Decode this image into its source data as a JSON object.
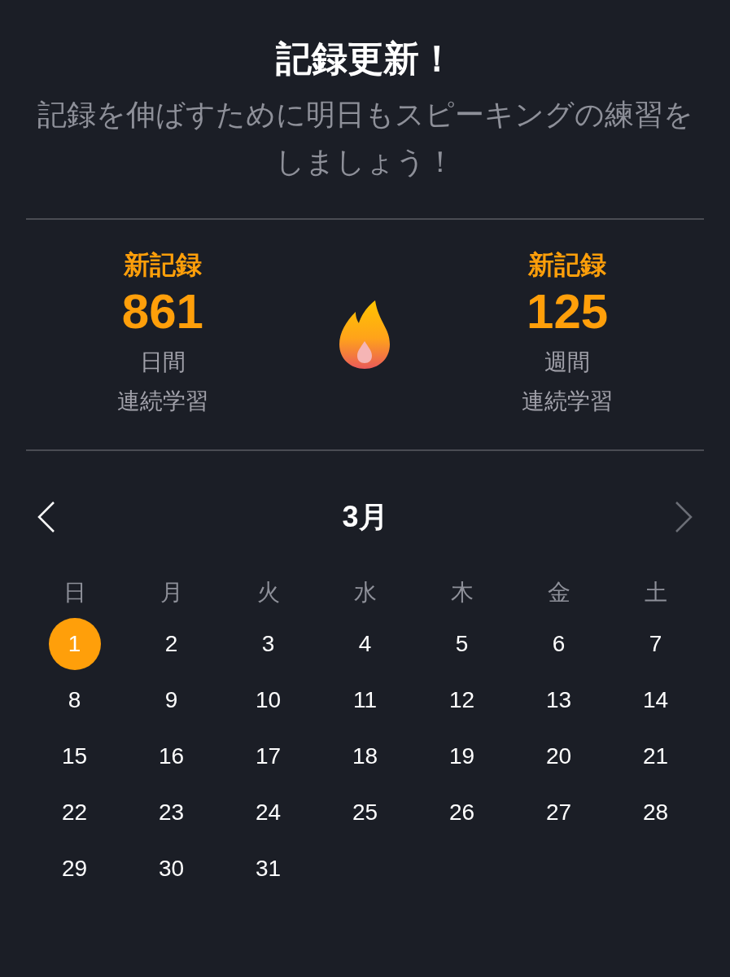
{
  "title": "記録更新！",
  "subtitle": "記録を伸ばすために明日もスピーキングの練習をしましょう！",
  "stats": [
    {
      "badge": "新記録",
      "value": "861",
      "unit": "日間",
      "label": "連続学習"
    },
    {
      "badge": "新記録",
      "value": "125",
      "unit": "週間",
      "label": "連続学習"
    }
  ],
  "calendar": {
    "month": "3月",
    "prev_disabled": false,
    "next_disabled": true,
    "weekdays": [
      "日",
      "月",
      "火",
      "水",
      "木",
      "金",
      "土"
    ],
    "days": [
      {
        "label": "1",
        "selected": true
      },
      {
        "label": "2",
        "selected": false
      },
      {
        "label": "3",
        "selected": false
      },
      {
        "label": "4",
        "selected": false
      },
      {
        "label": "5",
        "selected": false
      },
      {
        "label": "6",
        "selected": false
      },
      {
        "label": "7",
        "selected": false
      },
      {
        "label": "8",
        "selected": false
      },
      {
        "label": "9",
        "selected": false
      },
      {
        "label": "10",
        "selected": false
      },
      {
        "label": "11",
        "selected": false
      },
      {
        "label": "12",
        "selected": false
      },
      {
        "label": "13",
        "selected": false
      },
      {
        "label": "14",
        "selected": false
      },
      {
        "label": "15",
        "selected": false
      },
      {
        "label": "16",
        "selected": false
      },
      {
        "label": "17",
        "selected": false
      },
      {
        "label": "18",
        "selected": false
      },
      {
        "label": "19",
        "selected": false
      },
      {
        "label": "20",
        "selected": false
      },
      {
        "label": "21",
        "selected": false
      },
      {
        "label": "22",
        "selected": false
      },
      {
        "label": "23",
        "selected": false
      },
      {
        "label": "24",
        "selected": false
      },
      {
        "label": "25",
        "selected": false
      },
      {
        "label": "26",
        "selected": false
      },
      {
        "label": "27",
        "selected": false
      },
      {
        "label": "28",
        "selected": false
      },
      {
        "label": "29",
        "selected": false
      },
      {
        "label": "30",
        "selected": false
      },
      {
        "label": "31",
        "selected": false
      }
    ]
  }
}
